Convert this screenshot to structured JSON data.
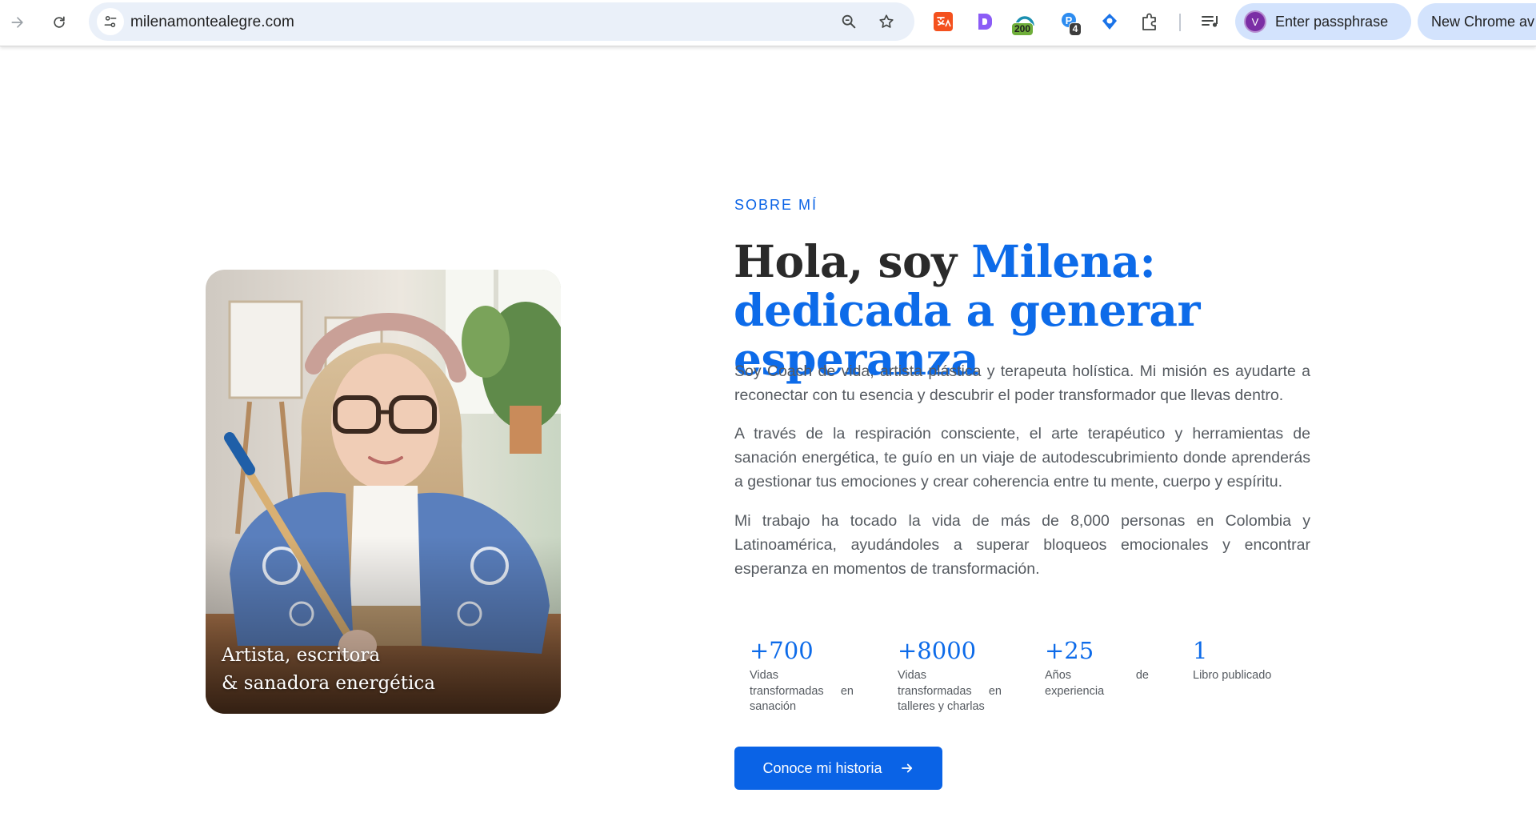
{
  "browser": {
    "url": "milenamontealegre.com",
    "extensions": [
      {
        "name": "translate-extension-icon"
      },
      {
        "name": "d-extension-icon"
      },
      {
        "name": "cloud-extension-icon",
        "badge": "200"
      },
      {
        "name": "p-extension-icon",
        "badge": "4"
      },
      {
        "name": "location-extension-icon"
      },
      {
        "name": "puzzle-extensions-icon"
      }
    ],
    "profile_label": "Enter passphrase",
    "profile_initial": "V",
    "update_label": "New Chrome av"
  },
  "about": {
    "eyebrow": "SOBRE MÍ",
    "heading_plain": "Hola, soy ",
    "heading_accent": "Milena: dedicada a generar esperanza",
    "photo_caption_line1": "Artista, escritora",
    "photo_caption_line2": "& sanadora energética",
    "paragraphs": [
      "Soy Coach de vida, artista plástica y terapeuta holística. Mi misión es ayudarte a reconectar con tu esencia y descubrir el poder transformador que llevas dentro.",
      "A través de la respiración consciente, el arte terapéutico y herramientas de sanación energética, te guío en un viaje de autodescubrimiento donde aprenderás a gestionar tus emociones y crear coherencia entre tu mente, cuerpo y espíritu.",
      "Mi trabajo ha tocado la vida de más de 8,000 personas en Colombia y Latinoamérica, ayudándoles a superar bloqueos emocionales y encontrar esperanza en momentos de transformación."
    ],
    "stats": [
      {
        "number": "+700",
        "label": "Vidas transformadas en sanación"
      },
      {
        "number": "+8000",
        "label": "Vidas transformadas en talleres y charlas"
      },
      {
        "number": "+25",
        "label": "Años de experiencia"
      },
      {
        "number": "1",
        "label": "Libro publicado"
      }
    ],
    "cta_label": "Conoce mi historia"
  },
  "colors": {
    "accent": "#0d6be9",
    "button": "#0a63e6",
    "body_text": "#555a60",
    "heading_text": "#2a2a2a"
  }
}
